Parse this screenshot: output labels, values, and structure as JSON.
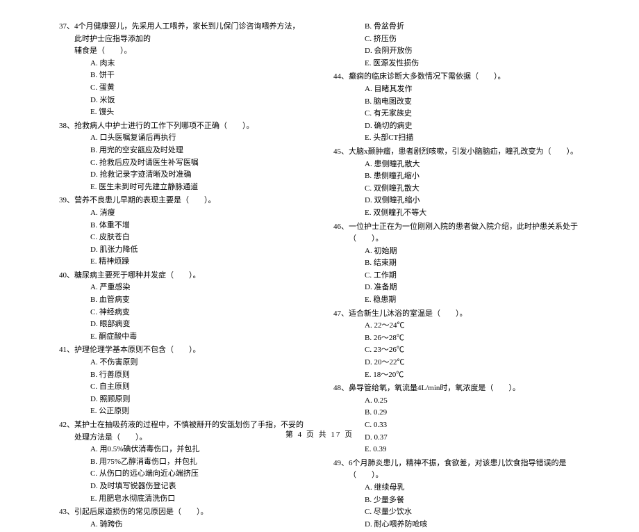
{
  "left": {
    "q37": {
      "text": "37、4个月健康婴儿，先采用人工喂养，家长到儿保门诊咨询喂养方法，此时护士应指导添加的",
      "text2": "辅食是（　　）。",
      "opts": [
        "A. 肉末",
        "B. 饼干",
        "C. 蛋黄",
        "D. 米饭",
        "E. 馒头"
      ]
    },
    "q38": {
      "text": "38、抢救病人中护士进行的工作下列哪项不正确（　　）。",
      "opts": [
        "A. 口头医嘱复诵后再执行",
        "B. 用完的空安瓿应及时处理",
        "C. 抢救后应及时请医生补写医嘱",
        "D. 抢救记录字迹清晰及时准确",
        "E. 医生未到时可先建立静脉通道"
      ]
    },
    "q39": {
      "text": "39、营养不良患儿早期的表现主要是（　　）。",
      "opts": [
        "A. 消瘦",
        "B. 体重不增",
        "C. 皮肤苍白",
        "D. 肌张力降低",
        "E. 精神烦躁"
      ]
    },
    "q40": {
      "text": "40、糖尿病主要死于哪种并发症（　　）。",
      "opts": [
        "A. 严重感染",
        "B. 血管病变",
        "C. 神经病变",
        "D. 眼部病变",
        "E. 酮症酸中毒"
      ]
    },
    "q41": {
      "text": "41、护理伦理学基本原则不包含（　　）。",
      "opts": [
        "A. 不伤害原则",
        "B. 行善原则",
        "C. 自主原则",
        "D. 照顾原则",
        "E. 公正原则"
      ]
    },
    "q42": {
      "text": "42、某护士在抽吸药液的过程中，不慎被掰开的安瓿划伤了手指，不妥的处理方法是（　　）。",
      "opts": [
        "A. 用0.5%碘伏消毒伤口，并包扎",
        "B. 用75%乙醇消毒伤口，并包扎",
        "C. 从伤口的远心端向近心端挤压",
        "D. 及时填写锐器伤登记表",
        "E. 用肥皂水彻底清洗伤口"
      ]
    },
    "q43": {
      "text": "43、引起后尿道损伤的常见原因是（　　）。",
      "opts": [
        "A. 骑跨伤"
      ]
    }
  },
  "right": {
    "q43cont": {
      "opts": [
        "B. 骨盆骨折",
        "C. 挤压伤",
        "D. 会阴开放伤",
        "E. 医源发性损伤"
      ]
    },
    "q44": {
      "text": "44、癫痫的临床诊断大多数情况下需依据（　　）。",
      "opts": [
        "A. 目睹其发作",
        "B. 脑电图改变",
        "C. 有无家族史",
        "D. 确切的病史",
        "E. 头部CT扫描"
      ]
    },
    "q45": {
      "text": "45、大脑x颞肿瘤，患者剧烈咳嗽，引发小脑脑疝，瞳孔改变为（　　）。",
      "opts": [
        "A. 患侧瞳孔散大",
        "B. 患侧瞳孔缩小",
        "C. 双侧瞳孔散大",
        "D. 双侧瞳孔缩小",
        "E. 双侧瞳孔不等大"
      ]
    },
    "q46": {
      "text": "46、一位护士正在为一位刚刚入院的患者做入院介绍，此时护患关系处于（　　）。",
      "opts": [
        "A. 初始期",
        "B. 结束期",
        "C. 工作期",
        "D. 准备期",
        "E. 稳患期"
      ]
    },
    "q47": {
      "text": "47、适合新生儿沐浴的室温是（　　）。",
      "opts": [
        "A. 22～24℃",
        "B. 26～28℃",
        "C. 23～26℃",
        "D. 20～22℃",
        "E. 18～20℃"
      ]
    },
    "q48": {
      "text": "48、鼻导管给氧，氧流量4L/min时，氧浓度是（　　）。",
      "opts": [
        "A. 0.25",
        "B. 0.29",
        "C. 0.33",
        "D. 0.37",
        "E. 0.39"
      ]
    },
    "q49": {
      "text": "49、6个月肺炎患儿，精神不振，食欲差，对该患儿饮食指导错误的是（　　）。",
      "opts": [
        "A. 继续母乳",
        "B. 少量多餐",
        "C. 尽量少饮水",
        "D. 耐心喂养防呛咳"
      ]
    }
  },
  "footer": "第 4 页 共 17 页"
}
